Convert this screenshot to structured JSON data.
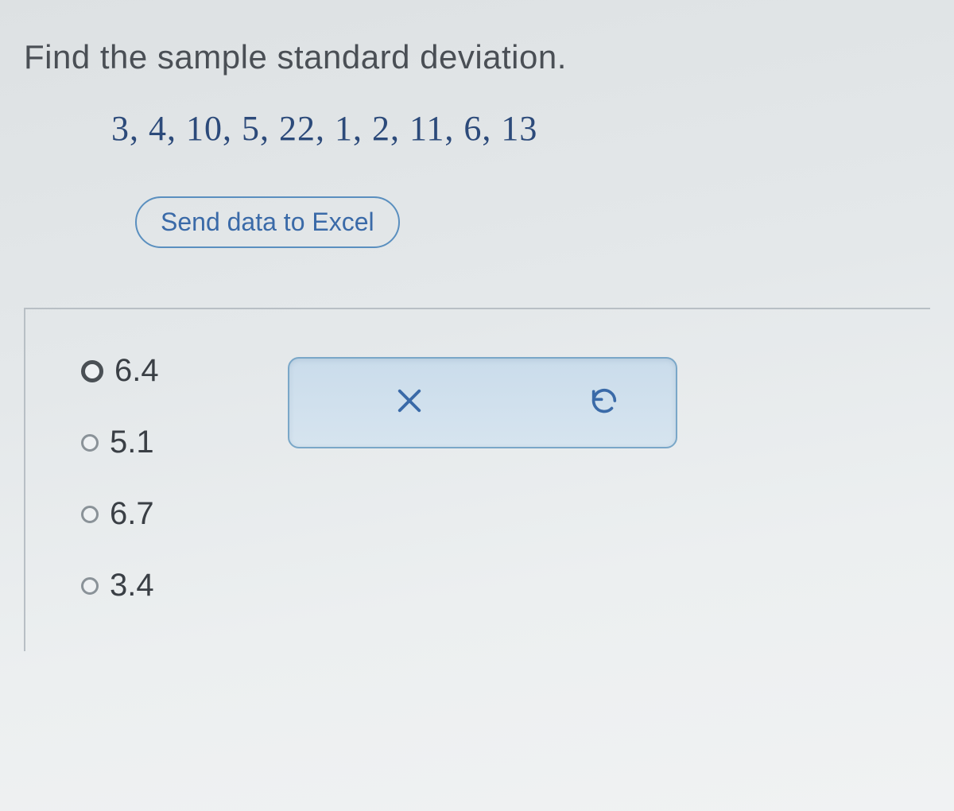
{
  "question": {
    "prompt": "Find the sample standard deviation.",
    "data_values": "3, 4, 10, 5, 22, 1, 2, 11, 6, 13",
    "send_button_label": "Send data to Excel"
  },
  "options": [
    {
      "label": "6.4",
      "selected": true
    },
    {
      "label": "5.1",
      "selected": false
    },
    {
      "label": "6.7",
      "selected": false
    },
    {
      "label": "3.4",
      "selected": false
    }
  ],
  "icons": {
    "clear": "x-icon",
    "undo": "undo-icon"
  }
}
